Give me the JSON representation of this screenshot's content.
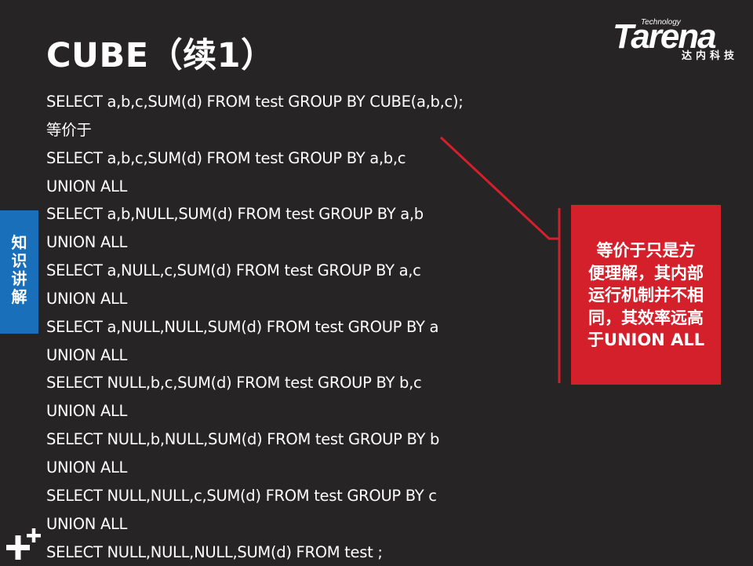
{
  "slide": {
    "title": "CUBE（续1）",
    "side_tab": {
      "label": "知\n识\n讲\n解"
    },
    "logo": {
      "brand": "Tarena",
      "tagline": "Technology",
      "chinese": "达内科技"
    },
    "code_lines": [
      "SELECT a,b,c,SUM(d)  FROM test GROUP BY CUBE(a,b,c);",
      "等价于",
      "SELECT a,b,c,SUM(d)  FROM test GROUP BY a,b,c",
      "UNION ALL",
      "SELECT a,b,NULL,SUM(d)  FROM test GROUP BY a,b",
      "UNION ALL",
      "SELECT a,NULL,c,SUM(d)  FROM test GROUP BY a,c",
      "UNION ALL",
      "SELECT a,NULL,NULL,SUM(d)  FROM test GROUP BY a",
      "UNION ALL",
      "SELECT NULL,b,c,SUM(d)  FROM test GROUP BY b,c",
      "UNION ALL",
      "SELECT NULL,b,NULL,SUM(d)  FROM test GROUP BY b",
      "UNION ALL",
      "SELECT NULL,NULL,c,SUM(d)  FROM test GROUP BY c",
      "UNION ALL",
      "SELECT NULL,NULL,NULL,SUM(d)  FROM test ;"
    ],
    "callout": {
      "text": "等价于只是方\n便理解，其内部\n运行机制并不相\n同，其效率远高\n于UNION ALL"
    },
    "colors": {
      "background": "#262425",
      "text": "#ffffff",
      "side_tab": "#1a6fba",
      "callout": "#d3202a",
      "connector": "#d3202a"
    },
    "icons": {
      "corner": "plus-icon"
    }
  }
}
